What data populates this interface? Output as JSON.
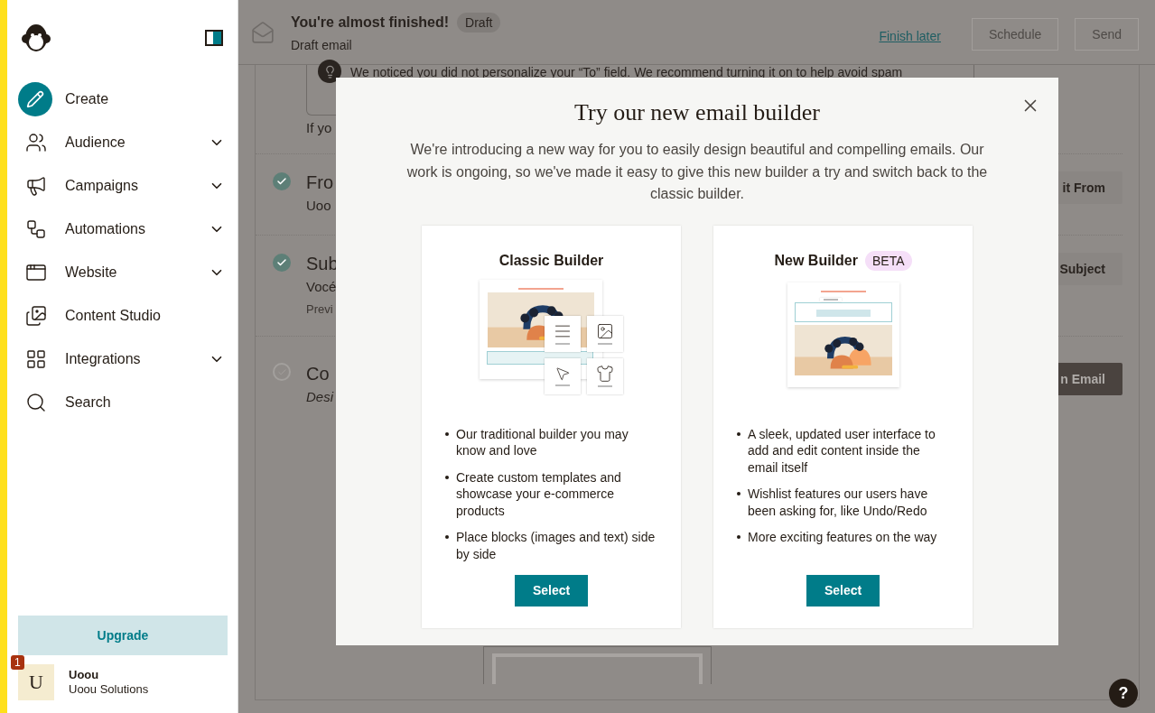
{
  "sidebar": {
    "nav": [
      {
        "label": "Create",
        "kind": "primary",
        "has_menu": false
      },
      {
        "label": "Audience",
        "kind": "link",
        "has_menu": true
      },
      {
        "label": "Campaigns",
        "kind": "link",
        "has_menu": true
      },
      {
        "label": "Automations",
        "kind": "link",
        "has_menu": true
      },
      {
        "label": "Website",
        "kind": "link",
        "has_menu": true
      },
      {
        "label": "Content Studio",
        "kind": "link",
        "has_menu": false
      },
      {
        "label": "Integrations",
        "kind": "link",
        "has_menu": true
      },
      {
        "label": "Search",
        "kind": "link",
        "has_menu": false
      }
    ],
    "upgrade": "Upgrade",
    "account": {
      "initial": "U",
      "badge": "1",
      "name": "Uoou",
      "org": "Uoou Solutions"
    }
  },
  "header": {
    "title": "You're almost finished!",
    "badge": "Draft",
    "subtitle": "Draft email",
    "link": "Finish later",
    "buttons": [
      {
        "label": "Schedule",
        "disabled": true
      },
      {
        "label": "Send",
        "disabled": true
      }
    ]
  },
  "notice": {
    "text": "We noticed you did not personalize your “To” field. We recommend turning it on to help avoid spam",
    "followup": "If yo"
  },
  "steps": [
    {
      "title": "Fro",
      "detail": "Uoo",
      "checked": true,
      "button": "it From",
      "primary": false
    },
    {
      "title": "Sub",
      "detail": "Vocé",
      "note": "Previ",
      "checked": true,
      "button": "Subject",
      "primary": false
    },
    {
      "title": "Co",
      "detail": "Desi",
      "checked": false,
      "button": "n Email",
      "primary": true
    }
  ],
  "modal": {
    "title": "Try our new email builder",
    "description": "We're introducing a new way for you to easily design beautiful and compelling emails. Our work is ongoing, so we've made it easy to give this new builder a try and switch back to the classic builder.",
    "options": [
      {
        "title": "Classic Builder",
        "kind": "classic",
        "points": [
          "Our traditional builder you may know and love",
          "Create custom templates and showcase your e-commerce products",
          "Place blocks (images and text) side by side"
        ],
        "button": "Select"
      },
      {
        "title": "New Builder",
        "badge": "BETA",
        "kind": "new",
        "points": [
          "A sleek, updated user interface to add and edit content inside the email itself",
          "Wishlist features our users have been asking for, like Undo/Redo",
          "More exciting features on the way"
        ],
        "button": "Select"
      }
    ]
  },
  "help": "?"
}
